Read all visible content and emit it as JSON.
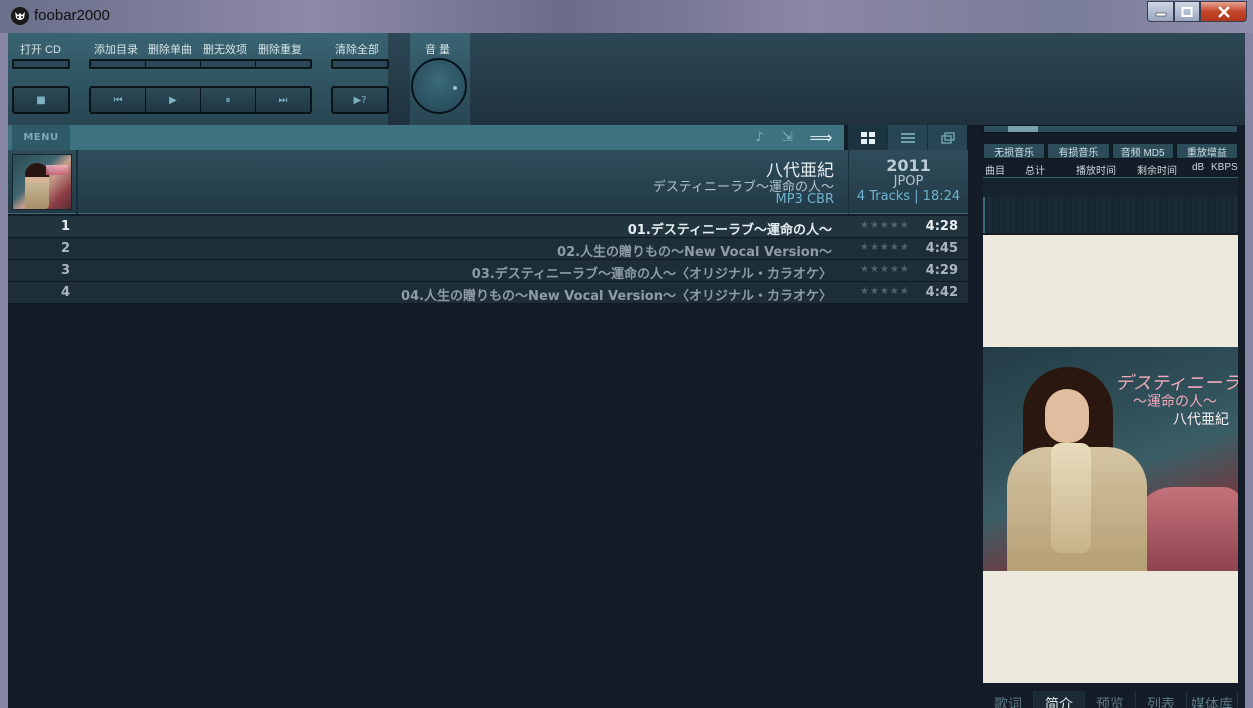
{
  "window": {
    "title": "foobar2000",
    "minimize_label": "",
    "maximize_label": "",
    "close_label": ""
  },
  "toolbar": {
    "open_cd": "打开 CD",
    "add_dir": "添加目录",
    "delete_single": "删除单曲",
    "delete_invalid": "删无效项",
    "delete_dupes": "删除重复",
    "clear_all": "清除全部",
    "volume": "音 量",
    "stop_glyph": "■",
    "prev_glyph": "⏮",
    "play_glyph": "▶",
    "pause_glyph": "⏸",
    "next_glyph": "⏭",
    "order_glyph": "▶?"
  },
  "playlist_strip": {
    "menu_label": "MENU"
  },
  "album": {
    "artist": "八代亜紀",
    "title": "デスティニーラブ～運命の人～",
    "codec": "MP3 CBR",
    "year": "2011",
    "genre": "JPOP",
    "tracks_summary": "4 Tracks | 18:24"
  },
  "tracks": [
    {
      "num": "1",
      "title": "01.デスティニーラブ～運命の人～",
      "rating": "★★★★★",
      "duration": "4:28"
    },
    {
      "num": "2",
      "title": "02.人生の贈りもの～New Vocal Version～",
      "rating": "★★★★★",
      "duration": "4:45"
    },
    {
      "num": "3",
      "title": "03.デスティニーラブ～運命の人～〈オリジナル・カラオケ〉",
      "rating": "★★★★★",
      "duration": "4:29"
    },
    {
      "num": "4",
      "title": "04.人生の贈りもの～New Vocal Version～〈オリジナル・カラオケ〉",
      "rating": "★★★★★",
      "duration": "4:42"
    }
  ],
  "right_panel": {
    "tags": [
      "无损音乐",
      "有损音乐",
      "音频 MD5",
      "重放增益"
    ],
    "cols": {
      "track": "曲目",
      "total": "总计",
      "play_time": "播放时间",
      "remaining": "剩余时间",
      "db": "dB",
      "kbps": "KBPS"
    },
    "cover_text": {
      "title": "デスティニーラブ",
      "subtitle": "～運命の人～",
      "artist": "八代亜紀"
    },
    "tabs": [
      "歌词",
      "简介",
      "预览",
      "列表",
      "媒体库"
    ],
    "active_tab": 1
  },
  "colors": {
    "accent": "#3e7281",
    "background": "#141d27",
    "highlight_text": "#6fb2d0"
  }
}
